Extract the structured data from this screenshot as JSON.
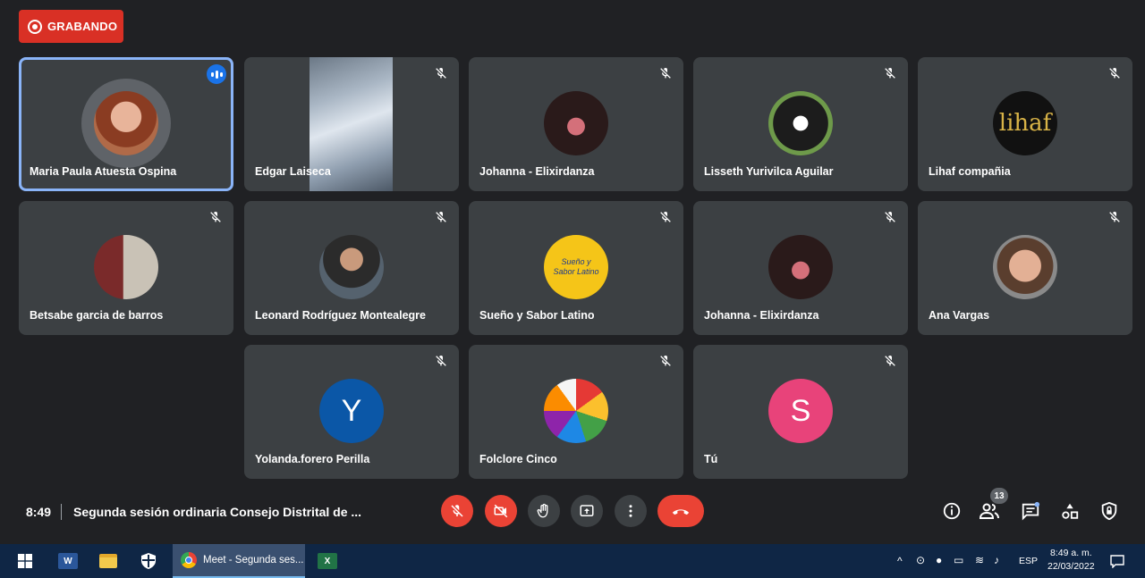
{
  "recording": {
    "label": "GRABANDO"
  },
  "participants": [
    {
      "name": "Maria Paula Atuesta Ospina"
    },
    {
      "name": "Edgar Laiseca"
    },
    {
      "name": "Johanna - Elixirdanza"
    },
    {
      "name": "Lisseth Yurivilca Aguilar"
    },
    {
      "name": "Lihaf compañia",
      "logo_text": "lihaf"
    },
    {
      "name": "Betsabe garcia de barros"
    },
    {
      "name": "Leonard Rodríguez Montealegre"
    },
    {
      "name": "Sueño y Sabor Latino",
      "logo_text": "Sueño y Sabor Latino"
    },
    {
      "name": "Johanna - Elixirdanza"
    },
    {
      "name": "Ana Vargas"
    },
    {
      "name": "Yolanda.forero Perilla",
      "initial": "Y"
    },
    {
      "name": "Folclore Cinco"
    },
    {
      "name": "Tú",
      "initial": "S"
    }
  ],
  "bottom_bar": {
    "time": "8:49",
    "meeting_title": "Segunda sesión ordinaria Consejo Distrital de ...",
    "participant_count": "13"
  },
  "taskbar": {
    "chrome_label": "Meet - Segunda ses...",
    "language": "ESP",
    "time": "8:49 a. m.",
    "date": "22/03/2022"
  },
  "colors": {
    "background": "#202124",
    "tile": "#3c4043",
    "danger": "#ea4335",
    "active_outline": "#8ab4f8",
    "avatar_blue": "#0b57a7",
    "avatar_pink": "#e8437a"
  }
}
